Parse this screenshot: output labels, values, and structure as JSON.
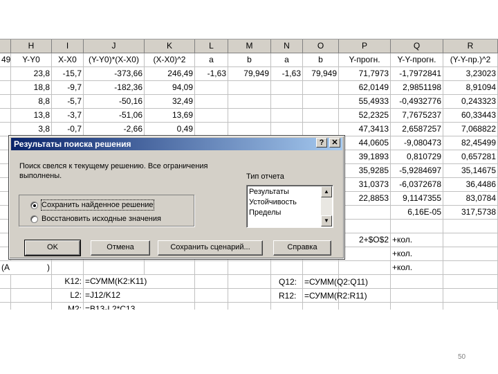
{
  "sheet": {
    "columns": [
      "H",
      "I",
      "J",
      "K",
      "L",
      "M",
      "N",
      "O",
      "P",
      "Q",
      "R"
    ],
    "header_row": {
      "g": "49",
      "h": "Y-Y0",
      "i": "X-X0",
      "j": "(Y-Y0)*(X-X0)",
      "k": "(X-X0)^2",
      "l": "a",
      "m": "b",
      "n": "a",
      "o": "b",
      "p": "Y-прогн.",
      "q": "Y-Y-прогн.",
      "r": "(Y-Y-пр.)^2"
    },
    "rows": [
      {
        "g": "",
        "h": "23,8",
        "i": "-15,7",
        "j": "-373,66",
        "k": "246,49",
        "l": "-1,63",
        "m": "79,949",
        "n": "-1,63",
        "o": "79,949",
        "p": "71,7973",
        "q": "-1,7972841",
        "r": "3,23023"
      },
      {
        "g": "",
        "h": "18,8",
        "i": "-9,7",
        "j": "-182,36",
        "k": "94,09",
        "l": "",
        "m": "",
        "n": "",
        "o": "",
        "p": "62,0149",
        "q": "2,9851198",
        "r": "8,91094"
      },
      {
        "g": "",
        "h": "8,8",
        "i": "-5,7",
        "j": "-50,16",
        "k": "32,49",
        "l": "",
        "m": "",
        "n": "",
        "o": "",
        "p": "55,4933",
        "q": "-0,4932776",
        "r": "0,243323"
      },
      {
        "g": "",
        "h": "13,8",
        "i": "-3,7",
        "j": "-51,06",
        "k": "13,69",
        "l": "",
        "m": "",
        "n": "",
        "o": "",
        "p": "52,2325",
        "q": "7,7675237",
        "r": "60,33443"
      },
      {
        "g": "",
        "h": "3,8",
        "i": "-0,7",
        "j": "-2,66",
        "k": "0,49",
        "l": "",
        "m": "",
        "n": "",
        "o": "",
        "p": "47,3413",
        "q": "2,6587257",
        "r": "7,068822"
      },
      {
        "g": "",
        "h": "",
        "i": "",
        "j": "",
        "k": "",
        "l": "",
        "m": "",
        "n": "",
        "o": "",
        "p": "44,0605",
        "q": "-9,080473",
        "r": "82,45499"
      },
      {
        "g": "",
        "h": "",
        "i": "",
        "j": "",
        "k": "",
        "l": "",
        "m": "",
        "n": "",
        "o": "",
        "p": "39,1893",
        "q": "0,810729",
        "r": "0,657281"
      },
      {
        "g": "",
        "h": "",
        "i": "",
        "j": "",
        "k": "",
        "l": "",
        "m": "",
        "n": "",
        "o": "",
        "p": "35,9285",
        "q": "-5,9284697",
        "r": "35,14675"
      },
      {
        "g": "",
        "h": "",
        "i": "",
        "j": "",
        "k": "",
        "l": "",
        "m": "",
        "n": "",
        "o": "",
        "p": "31,0373",
        "q": "-6,0372678",
        "r": "36,4486"
      },
      {
        "g": "",
        "h": "",
        "i": "",
        "j": "",
        "k": "",
        "l": "",
        "m": "",
        "n": "",
        "o": "",
        "p": "22,8853",
        "q": "9,1147355",
        "r": "83,0784"
      },
      {
        "g": "",
        "h": "",
        "i": "",
        "j": "",
        "k": "",
        "l": "",
        "m": "",
        "n": "",
        "o": "",
        "p": "",
        "q": "6,16E-05",
        "r": "317,5738"
      },
      {
        "g": "",
        "h": "",
        "i": "",
        "j": "",
        "k": "",
        "l": "",
        "m": "",
        "n": "",
        "o": "",
        "p": "",
        "q": "",
        "r": ""
      },
      {
        "g": "",
        "h": "",
        "i": "",
        "j": "",
        "k": "",
        "l": "",
        "m": "",
        "n": "",
        "o": "",
        "p": "2+$O$2",
        "q": "+кол.",
        "r": ""
      },
      {
        "g": "",
        "h": "",
        "i": "",
        "j": "",
        "k": "",
        "l": "",
        "m": "",
        "n": "",
        "o": "",
        "p": "",
        "q": "+кол.",
        "r": ""
      },
      {
        "g": "(A",
        "h": ")",
        "i": "",
        "j": "",
        "k": "",
        "l": "",
        "m": "",
        "n": "",
        "o": "",
        "p": "",
        "q": "+кол.",
        "r": ""
      },
      {
        "g": "",
        "h": "",
        "i": "K12:",
        "j": "=СУММ(K2:K11)",
        "k": "",
        "l": "",
        "m": "",
        "n": "",
        "o": "",
        "p": "",
        "q": "",
        "r": ""
      },
      {
        "g": "",
        "h": "",
        "i": "L2:",
        "j": "=J12/K12",
        "k": "",
        "l": "",
        "m": "",
        "n": "",
        "o": "",
        "p": "",
        "q": "",
        "r": ""
      },
      {
        "g": "",
        "h": "",
        "i": "M2:",
        "j": "=B13-L2*C13",
        "k": "",
        "l": "",
        "m": "",
        "n": "",
        "o": "",
        "p": "",
        "q": "",
        "r": ""
      },
      {
        "g": "",
        "h": "",
        "i": "",
        "j": "",
        "k": "",
        "l": "",
        "m": "",
        "n": "",
        "o": "",
        "p": "",
        "q": "",
        "r": ""
      }
    ],
    "tail_formulas": [
      {
        "label": "Q12:",
        "formula": "=СУММ(Q2:Q11)"
      },
      {
        "label": "R12:",
        "formula": "=СУММ(R2:R11)"
      }
    ]
  },
  "dialog": {
    "title": "Результаты поиска решения",
    "help_glyph": "?",
    "close_glyph": "✕",
    "message_line1": "Поиск свелся к текущему решению. Все ограничения",
    "message_line2": "выполнены.",
    "report_type_label": "Тип отчета",
    "report_types": [
      "Результаты",
      "Устойчивость",
      "Пределы"
    ],
    "options": [
      {
        "label": "Сохранить найденное решение",
        "selected": true
      },
      {
        "label": "Восстановить исходные значения",
        "selected": false
      }
    ],
    "buttons": {
      "ok": "OK",
      "cancel": "Отмена",
      "save_scenario": "Сохранить сценарий...",
      "help": "Справка"
    }
  },
  "slide_number": "50"
}
